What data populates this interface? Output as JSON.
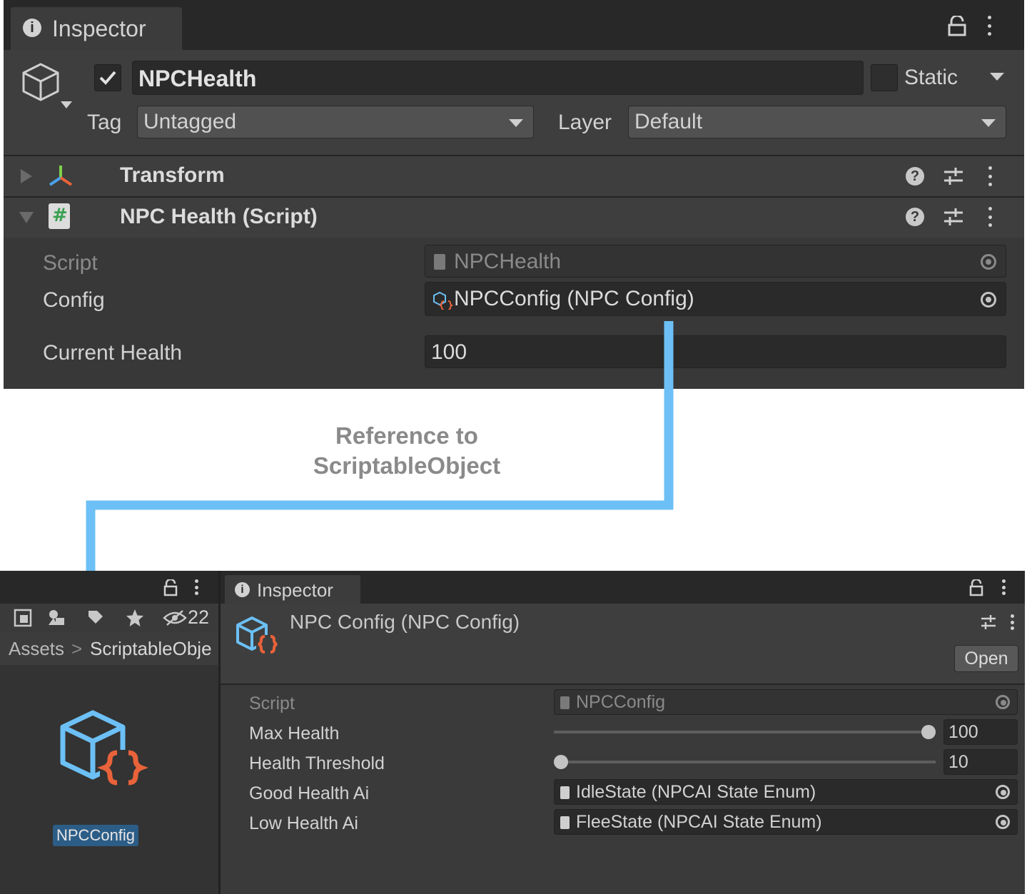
{
  "top_inspector": {
    "tab_label": "Inspector",
    "object_name": "NPCHealth",
    "static_label": "Static",
    "tag_label": "Tag",
    "tag_value": "Untagged",
    "layer_label": "Layer",
    "layer_value": "Default",
    "components": [
      {
        "name": "Transform"
      },
      {
        "name": "NPC Health (Script)"
      }
    ],
    "fields": {
      "script_label": "Script",
      "script_value": "NPCHealth",
      "config_label": "Config",
      "config_value": "NPCConfig (NPC Config)",
      "current_health_label": "Current Health",
      "current_health_value": "100"
    }
  },
  "annotation": {
    "line1": "Reference to",
    "line2": "ScriptableObject",
    "color": "#6cc0f5"
  },
  "project_panel": {
    "hidden_count": "22",
    "breadcrumb_root": "Assets",
    "breadcrumb_folder": "ScriptableObje",
    "asset_label": "NPCConfig"
  },
  "bottom_inspector": {
    "tab_label": "Inspector",
    "asset_title": "NPC Config (NPC Config)",
    "open_button": "Open",
    "fields": {
      "script_label": "Script",
      "script_value": "NPCConfig",
      "max_health_label": "Max Health",
      "max_health_value": "100",
      "max_health_fraction": 1.0,
      "health_threshold_label": "Health Threshold",
      "health_threshold_value": "10",
      "health_threshold_fraction": 0.0,
      "good_health_ai_label": "Good Health Ai",
      "good_health_ai_value": "IdleState (NPCAI State Enum)",
      "low_health_ai_label": "Low Health Ai",
      "low_health_ai_value": "FleeState (NPCAI State Enum)"
    }
  },
  "colors": {
    "panel_bg": "#383838",
    "accent_blue": "#6cc0f5",
    "icon_orange": "#e8623a",
    "selection_blue": "#2c5d87"
  }
}
